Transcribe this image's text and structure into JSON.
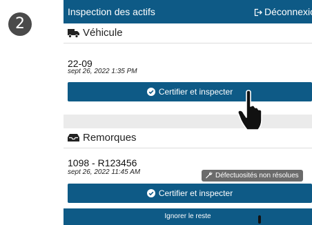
{
  "step_number": "2",
  "header": {
    "title": "Inspection des actifs",
    "logout_label": "Déconnexion"
  },
  "vehicle_section": {
    "heading": "Véhicule",
    "unit_id": "22-09",
    "date": "sept 26, 2022 1:35 PM",
    "button_label": "Certifier et inspecter"
  },
  "trailer_section": {
    "heading": "Remorques",
    "unit_id": "1098 - R123456",
    "date": "sept 26, 2022 11:45 AM",
    "badge_label": "Défectuosités non résolues",
    "button_label": "Certifier et inspecter"
  },
  "skip_button_label": "Ignorer le reste",
  "colors": {
    "primary": "#0e5a86",
    "badge": "#6b6b6b",
    "step_badge": "#4a4a4a"
  }
}
